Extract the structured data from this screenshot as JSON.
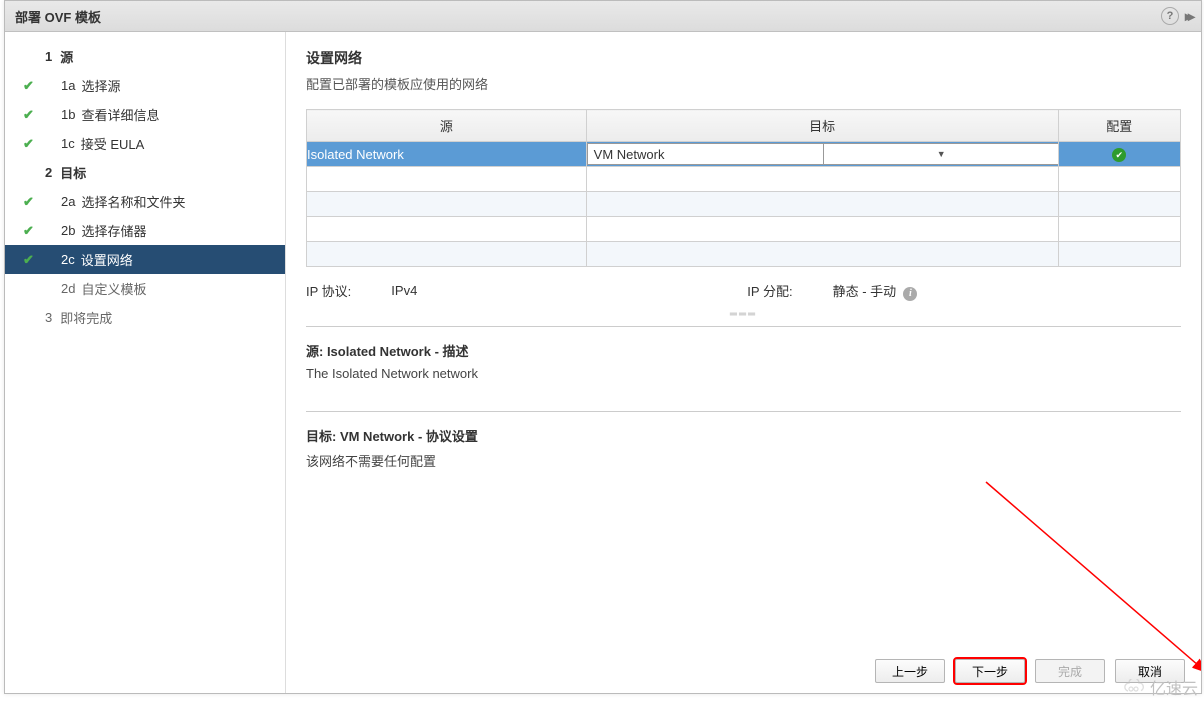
{
  "titlebar": {
    "title": "部署 OVF 模板"
  },
  "sidebar": {
    "major1": {
      "num": "1",
      "label": "源"
    },
    "s1a": {
      "num": "1a",
      "label": "选择源"
    },
    "s1b": {
      "num": "1b",
      "label": "查看详细信息"
    },
    "s1c": {
      "num": "1c",
      "label": "接受 EULA"
    },
    "major2": {
      "num": "2",
      "label": "目标"
    },
    "s2a": {
      "num": "2a",
      "label": "选择名称和文件夹"
    },
    "s2b": {
      "num": "2b",
      "label": "选择存储器"
    },
    "s2c": {
      "num": "2c",
      "label": "设置网络"
    },
    "s2d": {
      "num": "2d",
      "label": "自定义模板"
    },
    "major3": {
      "num": "3",
      "label": "即将完成"
    }
  },
  "content": {
    "heading": "设置网络",
    "subtitle": "配置已部署的模板应使用的网络",
    "table": {
      "col_source": "源",
      "col_target": "目标",
      "col_config": "配置",
      "row1_source": "Isolated Network",
      "row1_target": "VM Network"
    },
    "ip_protocol_label": "IP 协议:",
    "ip_protocol_value": "IPv4",
    "ip_alloc_label": "IP 分配:",
    "ip_alloc_value": "静态 - 手动",
    "source_section_title": "源: Isolated Network - 描述",
    "source_section_text": "The Isolated Network network",
    "target_section_title": "目标: VM Network - 协议设置",
    "target_section_text": "该网络不需要任何配置"
  },
  "footer": {
    "back": "上一步",
    "next": "下一步",
    "finish": "完成",
    "cancel": "取消"
  },
  "watermark": "亿速云"
}
